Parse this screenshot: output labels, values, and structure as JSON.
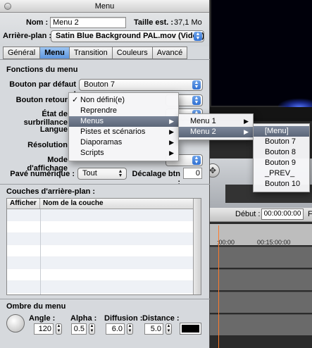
{
  "window": {
    "title": "Menu"
  },
  "header": {
    "nom_label": "Nom :",
    "nom_value": "Menu 2",
    "taille_label": "Taille est. :",
    "taille_value": "37,1 Mo",
    "arriere_label": "Arrière-plan :",
    "arriere_value": "Satin Blue Background PAL.mov (Vidéo)"
  },
  "tabs": [
    "Général",
    "Menu",
    "Transition",
    "Couleurs",
    "Avancé"
  ],
  "active_tab": "Menu",
  "fonctions": {
    "title": "Fonctions du menu",
    "bouton_defaut_label": "Bouton par défaut :",
    "bouton_defaut_value": "Bouton 7",
    "bouton_retour_label": "Bouton retour",
    "etat_label": "État de surbrillance",
    "langue_label": "Langue",
    "resolution_label": "Résolution",
    "mode_label": "Mode d'affichage",
    "pave_label": "Pavé numérique :",
    "pave_value": "Tout",
    "decalage_label": "Décalage btn :",
    "decalage_value": "0"
  },
  "couches": {
    "title": "Couches d'arrière-plan :",
    "col_afficher": "Afficher",
    "col_nom": "Nom de la couche"
  },
  "ombre": {
    "title": "Ombre du menu",
    "angle_label": "Angle :",
    "angle_value": "120",
    "alpha_label": "Alpha :",
    "alpha_value": "0.5",
    "diffusion_label": "Diffusion :",
    "diffusion_value": "6.0",
    "distance_label": "Distance :",
    "distance_value": "5.0",
    "shadow_color": "#000000"
  },
  "menu_level1": {
    "items": [
      "Non défini(e)",
      "Reprendre",
      "Menus",
      "Pistes et scénarios",
      "Diaporamas",
      "Scripts"
    ],
    "checked_index": 0,
    "highlighted_index": 2
  },
  "menu_level2": {
    "items": [
      "Menu 1",
      "Menu 2"
    ],
    "highlighted_index": 1
  },
  "menu_level3": {
    "items": [
      "[Menu]",
      "Bouton 7",
      "Bouton 8",
      "Bouton 9",
      "_PREV_",
      "Bouton 10"
    ],
    "highlighted_index": 0
  },
  "background_app": {
    "debut_label": "Début :",
    "debut_value": "00:00:00:00",
    "debut_suffix": "F",
    "ruler_tick_1": ":00:00",
    "ruler_tick_2": "00:15:00:00",
    "cursor_color": "#ff7a2a"
  }
}
